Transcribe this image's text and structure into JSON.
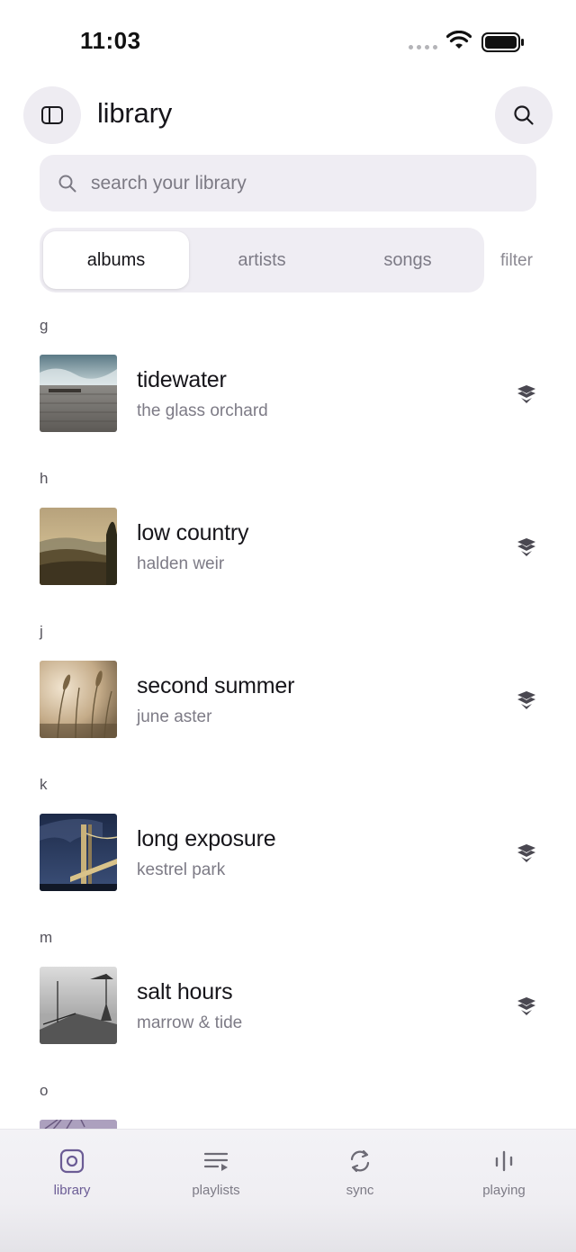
{
  "status_bar": {
    "time": "11:03"
  },
  "header": {
    "title": "library",
    "sidebar_icon": "sidebar-icon",
    "search_icon": "search-icon"
  },
  "search": {
    "placeholder": "search your library"
  },
  "tabs": [
    {
      "label": "albums",
      "active": true
    },
    {
      "label": "artists",
      "active": false
    },
    {
      "label": "songs",
      "active": false
    }
  ],
  "filter_label": "filter",
  "sections": [
    {
      "letter": "g",
      "album": {
        "title": "tidewater",
        "artist": "the glass orchard",
        "cover": "pier-over-water",
        "icon": "download-stack-icon"
      }
    },
    {
      "letter": "h",
      "album": {
        "title": "low country",
        "artist": "halden weir",
        "cover": "hills-sunset",
        "icon": "download-stack-icon"
      }
    },
    {
      "letter": "j",
      "album": {
        "title": "second summer",
        "artist": "june aster",
        "cover": "wheat-field",
        "icon": "download-stack-icon"
      }
    },
    {
      "letter": "k",
      "album": {
        "title": "long exposure",
        "artist": "kestrel park",
        "cover": "night-bridge",
        "icon": "download-stack-icon"
      }
    },
    {
      "letter": "m",
      "album": {
        "title": "salt hours",
        "artist": "marrow & tide",
        "cover": "bw-pier",
        "icon": "download-stack-icon"
      }
    },
    {
      "letter": "o",
      "album": {
        "title": "",
        "artist": "",
        "cover": "purple-tree",
        "icon": ""
      }
    }
  ],
  "tabbar": [
    {
      "label": "library",
      "icon": "library-icon",
      "active": true
    },
    {
      "label": "playlists",
      "icon": "playlists-icon",
      "active": false
    },
    {
      "label": "sync",
      "icon": "sync-icon",
      "active": false
    },
    {
      "label": "playing",
      "icon": "playing-icon",
      "active": false
    }
  ],
  "colors": {
    "accent": "#6b5c95",
    "field_bg": "#efedf3",
    "text_primary": "#16151a",
    "text_secondary": "#7d7b86"
  }
}
